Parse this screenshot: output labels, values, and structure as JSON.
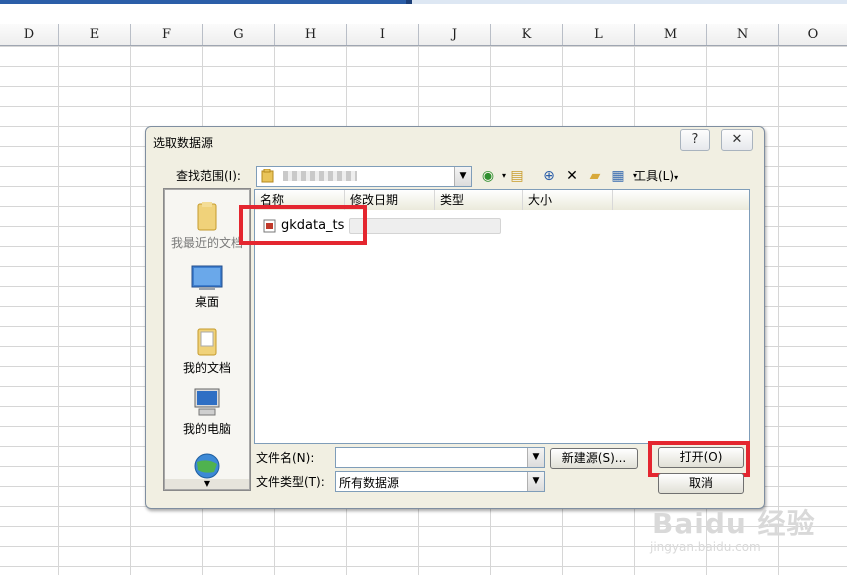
{
  "columns": [
    "D",
    "E",
    "F",
    "G",
    "H",
    "I",
    "J",
    "K",
    "L",
    "M",
    "N",
    "O"
  ],
  "dialog": {
    "title": "选取数据源",
    "help_label": "?",
    "close_label": "✕",
    "lookin_label": "查找范围(I):",
    "lookin_value": "",
    "tools_label": "工具(L)",
    "places": [
      {
        "label": "我最近的文档"
      },
      {
        "label": "桌面"
      },
      {
        "label": "我的文档"
      },
      {
        "label": "我的电脑"
      }
    ],
    "list_headers": [
      "名称",
      "修改日期",
      "类型",
      "大小"
    ],
    "files": [
      {
        "name": "gkdata_ts"
      }
    ],
    "filename_label": "文件名(N):",
    "filename_value": "",
    "filetype_label": "文件类型(T):",
    "filetype_value": "所有数据源",
    "new_source_label": "新建源(S)...",
    "open_label": "打开(O)",
    "cancel_label": "取消"
  },
  "watermark": {
    "logo": "Baidu 经验",
    "url": "jingyan.baidu.com"
  },
  "colors": {
    "highlight": "#e4262f",
    "dialog_bg": "#f1efe2"
  }
}
